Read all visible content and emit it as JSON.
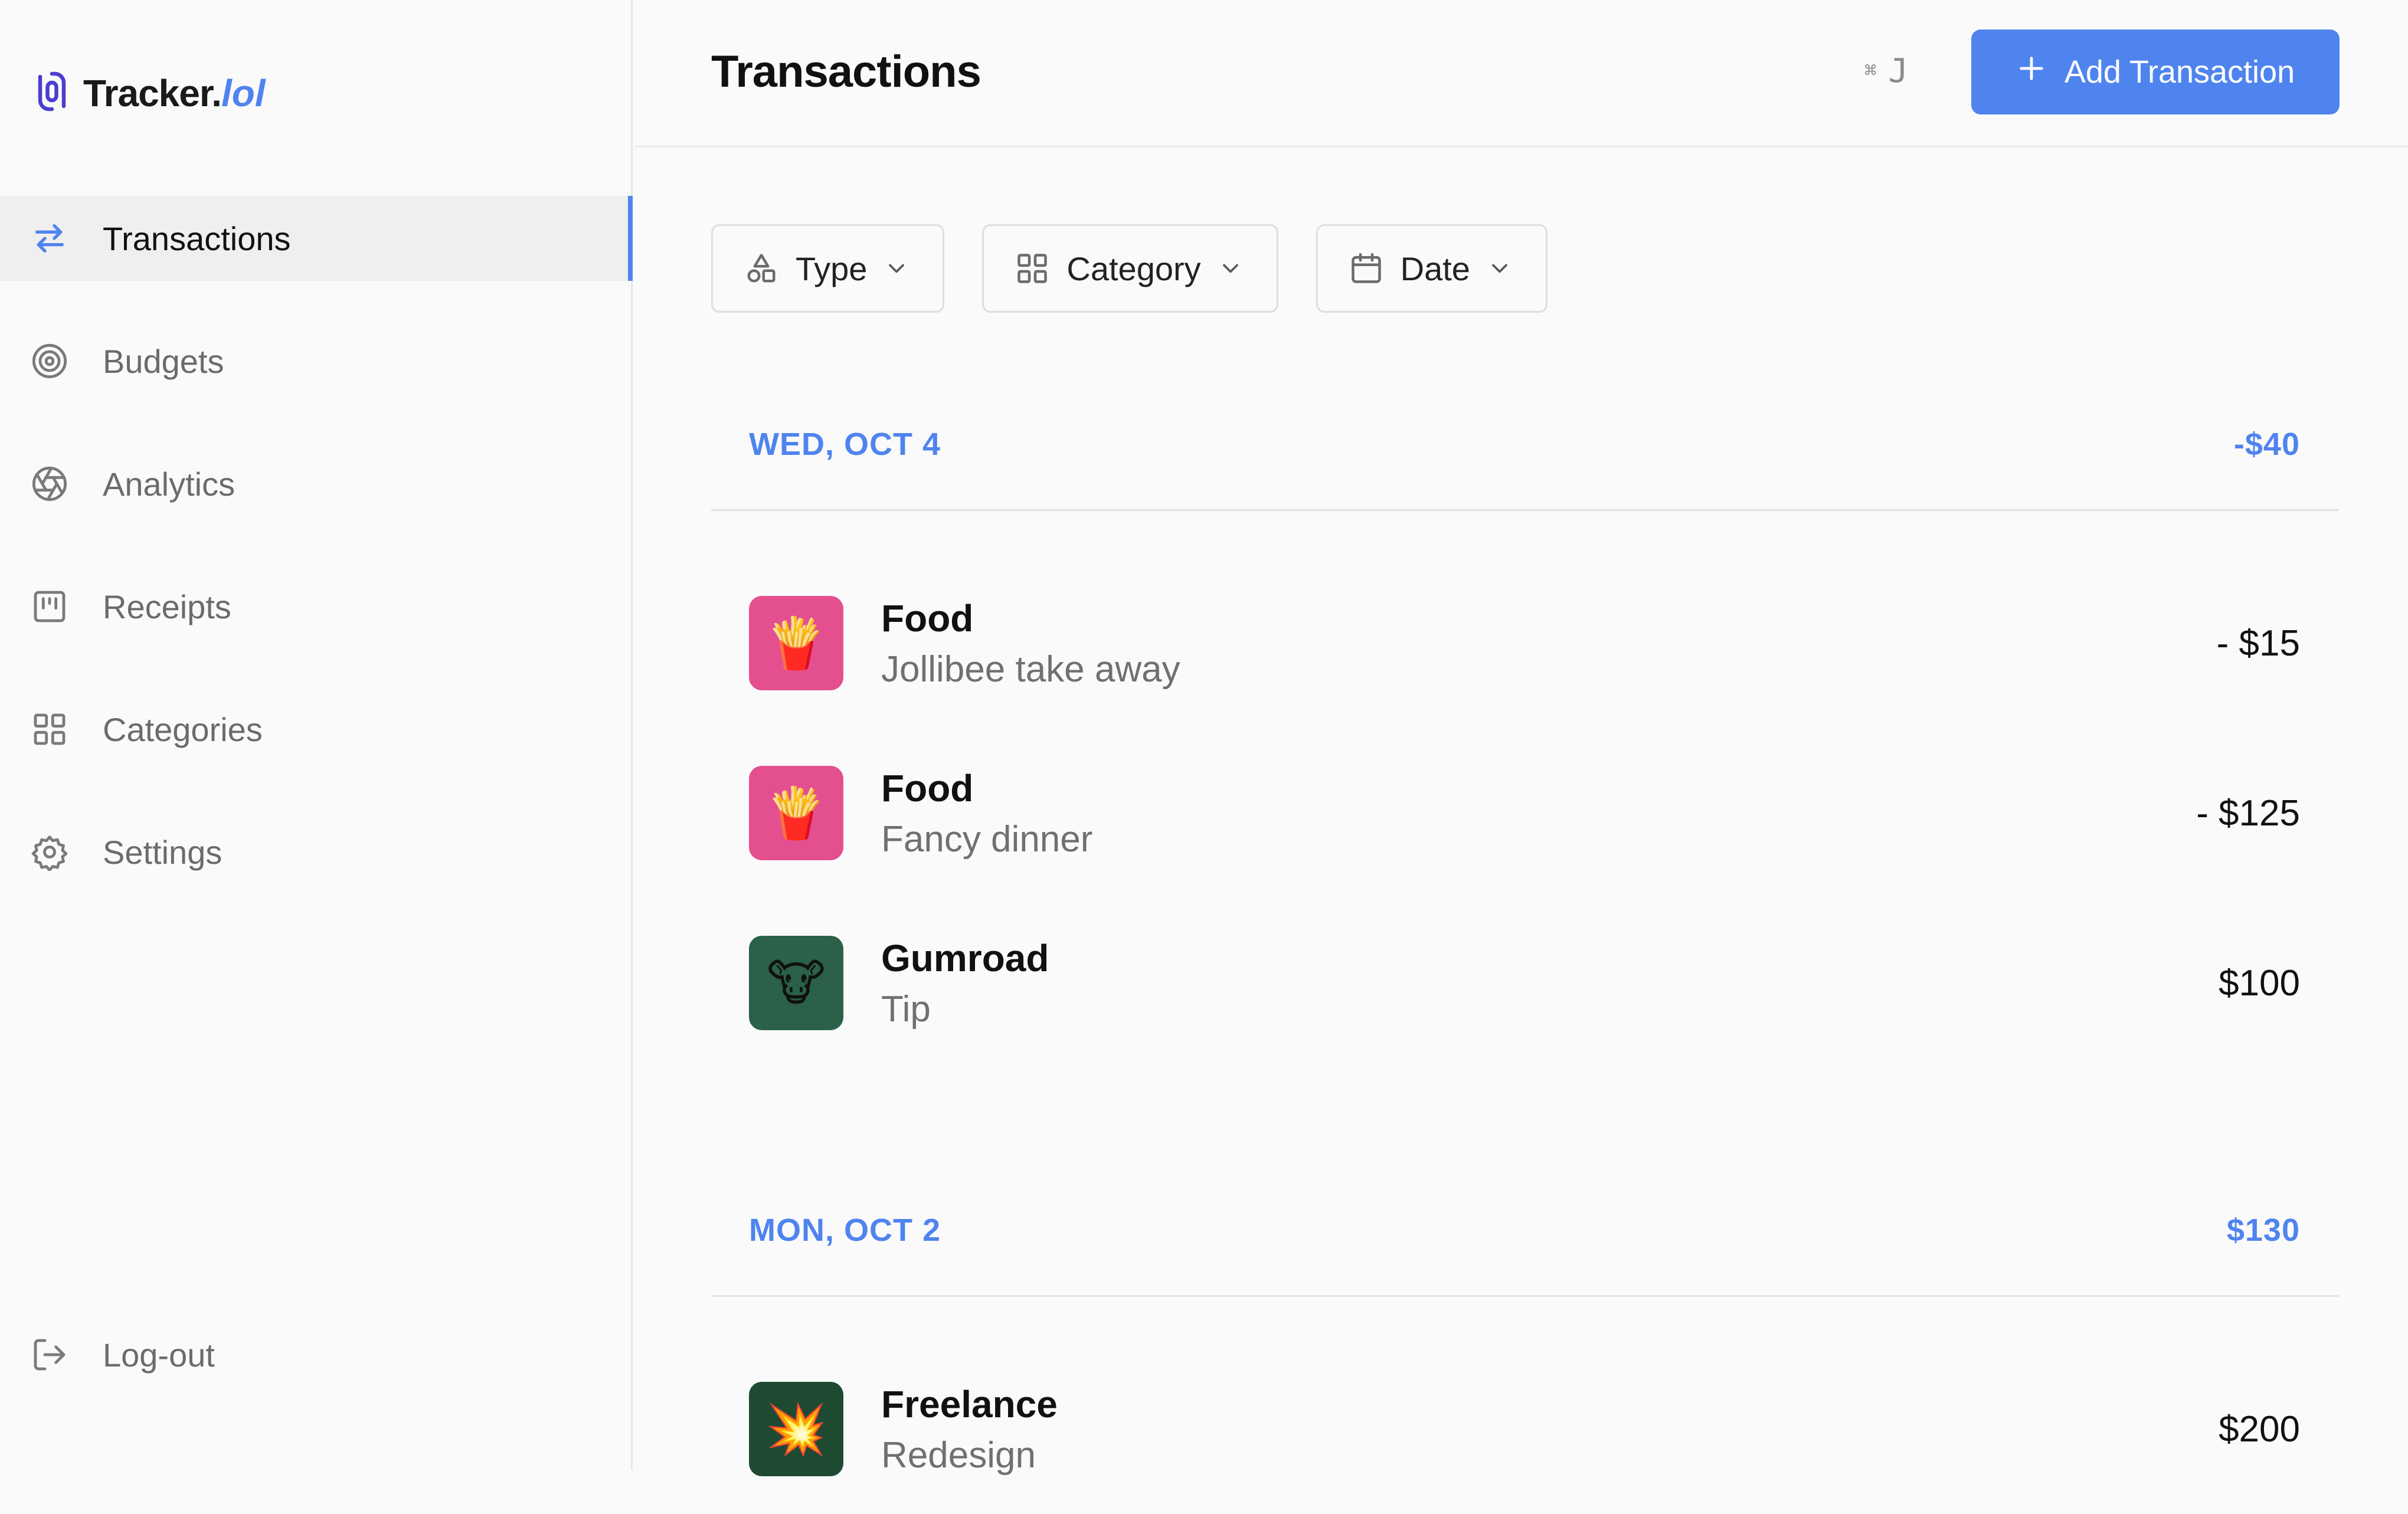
{
  "brand": {
    "name": "Tracker.",
    "suffix": "lol",
    "logo_icon": "link-icon",
    "accent": "#4f84ef"
  },
  "sidebar": {
    "items": [
      {
        "label": "Transactions",
        "icon": "arrows-swap-icon",
        "active": true
      },
      {
        "label": "Budgets",
        "icon": "target-icon",
        "active": false
      },
      {
        "label": "Analytics",
        "icon": "aperture-icon",
        "active": false
      },
      {
        "label": "Receipts",
        "icon": "receipt-icon",
        "active": false
      },
      {
        "label": "Categories",
        "icon": "grid-icon",
        "active": false
      },
      {
        "label": "Settings",
        "icon": "gear-icon",
        "active": false
      }
    ],
    "logout": {
      "label": "Log-out",
      "icon": "logout-icon"
    }
  },
  "header": {
    "title": "Transactions",
    "shortcut_symbol": "⌘",
    "shortcut_key": "J",
    "add_button": "Add Transaction"
  },
  "filters": [
    {
      "label": "Type",
      "icon": "shapes-icon"
    },
    {
      "label": "Category",
      "icon": "grid-icon"
    },
    {
      "label": "Date",
      "icon": "calendar-icon"
    }
  ],
  "groups": [
    {
      "date": "WED, OCT 4",
      "total": "-$40",
      "transactions": [
        {
          "title": "Food",
          "description": "Jollibee take away",
          "amount": "- $15",
          "emoji": "🍟",
          "color": "#e4508f"
        },
        {
          "title": "Food",
          "description": "Fancy dinner",
          "amount": "- $125",
          "emoji": "🍟",
          "color": "#e4508f"
        },
        {
          "title": "Gumroad",
          "description": "Tip",
          "amount": "$100",
          "emoji": "🐮",
          "color": "#2a6148"
        }
      ]
    },
    {
      "date": "MON, OCT 2",
      "total": "$130",
      "transactions": [
        {
          "title": "Freelance",
          "description": "Redesign",
          "amount": "$200",
          "emoji": "💥",
          "color": "#1e4a32"
        }
      ]
    }
  ]
}
